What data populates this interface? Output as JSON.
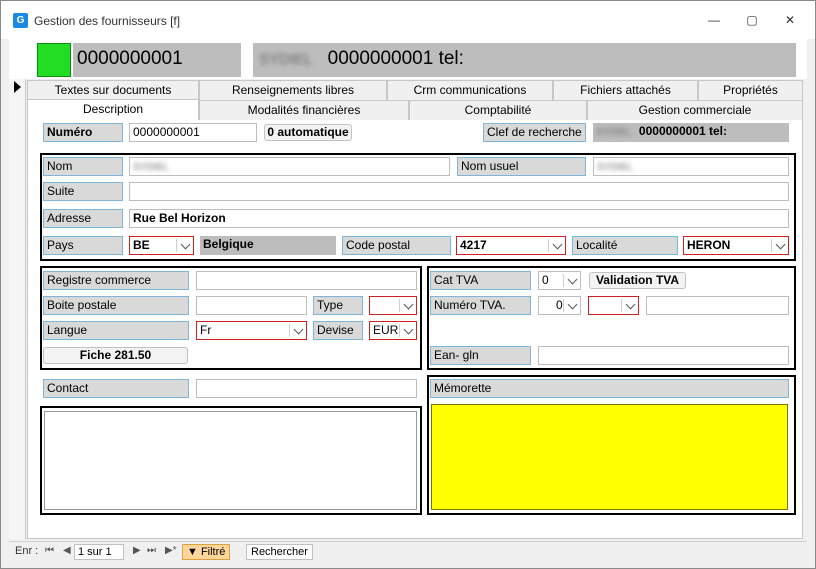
{
  "window": {
    "title": "Gestion des fournisseurs [f]",
    "icon": "app-icon",
    "minimize": "—",
    "restore": "▢",
    "close": "✕"
  },
  "header": {
    "status_color": "#22dd22",
    "code": "0000000001",
    "summary_code": "0000000001  tel:",
    "summary_name": "SYDIEL"
  },
  "tabs": {
    "row1": [
      "Textes sur documents",
      "Renseignements libres",
      "Crm communications",
      "Fichiers attachés",
      "Propriétés"
    ],
    "row2": [
      "Description",
      "Modalités financières",
      "Comptabilité",
      "Gestion commerciale"
    ],
    "active": "Description"
  },
  "form": {
    "numero_label": "Numéro",
    "numero_value": "0000000001",
    "auto_button": "0 automatique",
    "clef_label": "Clef de recherche",
    "clef_name": "SYDIEL",
    "clef_value": "0000000001  tel:",
    "nom_label": "Nom",
    "nom_value": "SYDIEL",
    "nom_usuel_label": "Nom usuel",
    "nom_usuel_value": "SYDIEL",
    "suite_label": "Suite",
    "suite_value": "",
    "adresse_label": "Adresse",
    "adresse_value": "Rue Bel Horizon",
    "pays_label": "Pays",
    "pays_value": "BE",
    "pays_name": "Belgique",
    "code_postal_label": "Code postal",
    "code_postal_value": "4217",
    "localite_label": "Localité",
    "localite_value": "HERON",
    "registre_label": "Registre commerce",
    "registre_value": "",
    "boite_label": "Boite postale",
    "boite_value": "",
    "type_label": "Type",
    "type_value": "",
    "langue_label": "Langue",
    "langue_value": "Fr",
    "devise_label": "Devise",
    "devise_value": "EUR",
    "fiche_button": "Fiche 281.50",
    "cat_tva_label": "Cat TVA",
    "cat_tva_value": "0",
    "validation_button": "Validation TVA",
    "numero_tva_label": "Numéro TVA.",
    "numero_tva_value": "0",
    "numero_tva_country": "",
    "numero_tva_number": "",
    "ean_label": "Ean- gln",
    "ean_value": "",
    "contact_label": "Contact",
    "contact_value": "",
    "memorette_label": "Mémorette",
    "memo_color": "#ffff00"
  },
  "statusbar": {
    "enr_label": "Enr :",
    "first": "⏮",
    "prev": "◀",
    "position": "1 sur 1",
    "next": "▶",
    "last": "⏭",
    "new": "▶*",
    "filter_label": "Filtré",
    "search_label": "Rechercher"
  }
}
